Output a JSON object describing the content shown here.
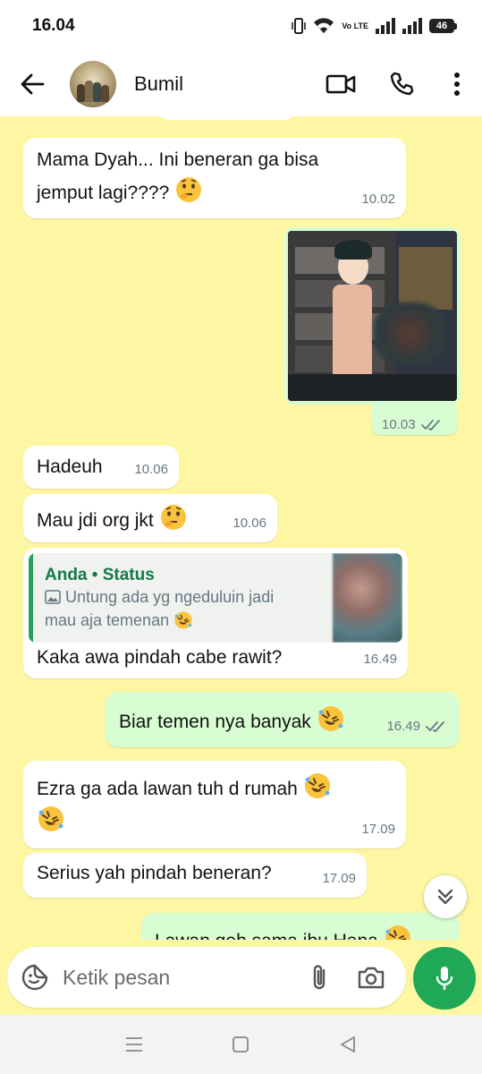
{
  "status_bar": {
    "time": "16.04",
    "volte": "Vo LTE",
    "battery": "46",
    "icons": [
      "vibrate-icon",
      "wifi-icon",
      "volte-icon",
      "signal-icon",
      "signal-icon",
      "battery-icon"
    ]
  },
  "header": {
    "contact_name": "Bumil",
    "icons": [
      "back-arrow-icon",
      "video-call-icon",
      "phone-icon",
      "more-vert-icon"
    ]
  },
  "messages": [
    {
      "id": "m1",
      "direction": "in",
      "text_line1": "Mama Dyah... Ini beneran ga bisa",
      "text_line2": "jemput lagi????",
      "emoji": "thinking-face",
      "time": "10.02"
    },
    {
      "id": "m2",
      "direction": "out",
      "type": "image",
      "time": "10.03",
      "status": "read"
    },
    {
      "id": "m3",
      "direction": "in",
      "text": "Hadeuh",
      "time": "10.06"
    },
    {
      "id": "m4",
      "direction": "in",
      "text": "Mau jdi org jkt",
      "emoji": "thinking-face",
      "time": "10.06"
    },
    {
      "id": "m5",
      "direction": "in",
      "quote": {
        "author": "Anda • Status",
        "line1": "Untung ada yg ngeduluin jadi",
        "line2": "mau aja temenan",
        "emoji": "rolling-laughing-face"
      },
      "text": "Kaka awa pindah cabe rawit?",
      "time": "16.49"
    },
    {
      "id": "m6",
      "direction": "out",
      "text": "Biar temen nya banyak",
      "emoji": "rolling-laughing-face",
      "time": "16.49",
      "status": "read"
    },
    {
      "id": "m7",
      "direction": "in",
      "text": "Ezra ga ada lawan tuh d rumah",
      "emoji": "rolling-laughing-face",
      "time": "17.09"
    },
    {
      "id": "m8",
      "direction": "in",
      "text": "Serius yah pindah beneran?",
      "time": "17.09"
    },
    {
      "id": "m9",
      "direction": "out",
      "text": "Lawan geh sama ibu Hana",
      "emoji": "rolling-laughing-face"
    }
  ],
  "input": {
    "placeholder": "Ketik pesan",
    "icons": [
      "sticker-icon",
      "attach-icon",
      "camera-icon",
      "mic-icon"
    ]
  },
  "nav_bar": {
    "icons": [
      "recents-icon",
      "home-icon",
      "back-icon"
    ]
  },
  "colors": {
    "chat_background": "#fdf7a4",
    "incoming_bubble": "#ffffff",
    "outgoing_bubble": "#d9fdd3",
    "accent_green": "#1fa855",
    "read_ticks": "#667781"
  }
}
